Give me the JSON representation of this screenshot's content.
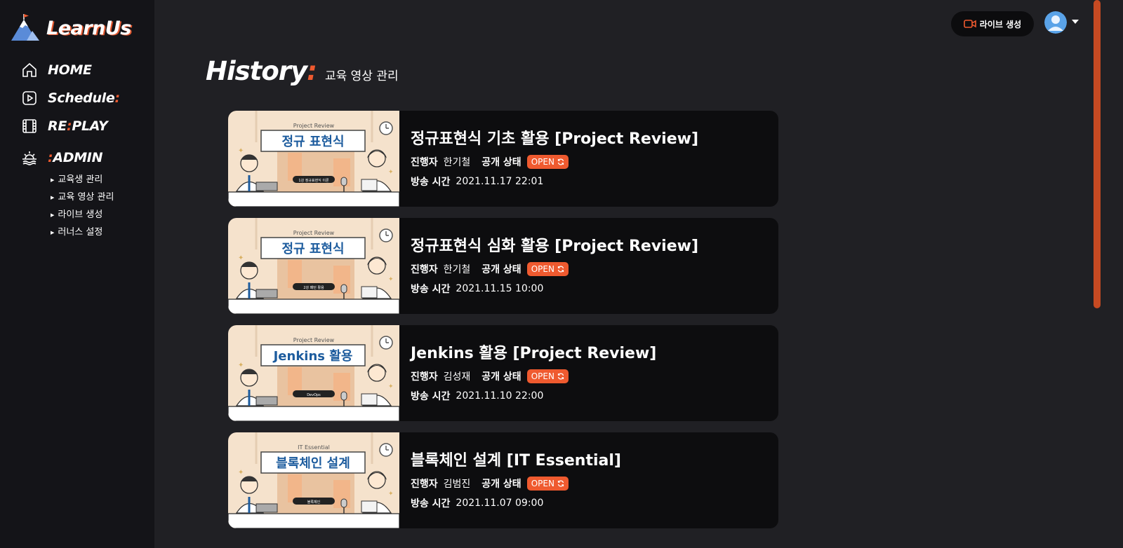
{
  "brand": {
    "name": "LearnUs"
  },
  "nav": {
    "home": "HOME",
    "schedule": "Schedule",
    "schedule_suffix": ":",
    "replay_prefix": "RE",
    "replay_colon": ":",
    "replay_suffix": "PLAY",
    "admin_colon": ":",
    "admin": "ADMIN",
    "sub_items": [
      "교육생 관리",
      "교육 영상 관리",
      "라이브 생성",
      "러너스 설정"
    ]
  },
  "topbar": {
    "live_button": "라이브 생성"
  },
  "page": {
    "title": "History",
    "title_colon": ":",
    "subtitle": "교육 영상 관리"
  },
  "labels": {
    "host": "진행자",
    "status": "공개 상태",
    "time": "방송 시간"
  },
  "videos": [
    {
      "title": "정규표현식 기초 활용 [Project Review]",
      "host": "한기철",
      "status": "OPEN",
      "time": "2021.11.17 22:01",
      "thumb_series": "Project Review",
      "thumb_title": "정규 표현식",
      "thumb_tag": "1강 정규표현식 이론"
    },
    {
      "title": "정규표현식 심화 활용 [Project Review]",
      "host": "한기철",
      "status": "OPEN",
      "time": "2021.11.15 10:00",
      "thumb_series": "Project Review",
      "thumb_title": "정규 표현식",
      "thumb_tag": "2강 패턴 활용"
    },
    {
      "title": "Jenkins 활용 [Project Review]",
      "host": "김성재",
      "status": "OPEN",
      "time": "2021.11.10 22:00",
      "thumb_series": "Project Review",
      "thumb_title": "Jenkins 활용",
      "thumb_tag": "DevOps"
    },
    {
      "title": "블록체인 설계 [IT Essential]",
      "host": "김범진",
      "status": "OPEN",
      "time": "2021.11.07 09:00",
      "thumb_series": "IT Essential",
      "thumb_title": "블록체인 설계",
      "thumb_tag": "블록체인"
    }
  ],
  "colors": {
    "accent": "#ef5a2f",
    "background": "#202024",
    "sidebar": "#141418",
    "card": "#0d0d0f"
  }
}
